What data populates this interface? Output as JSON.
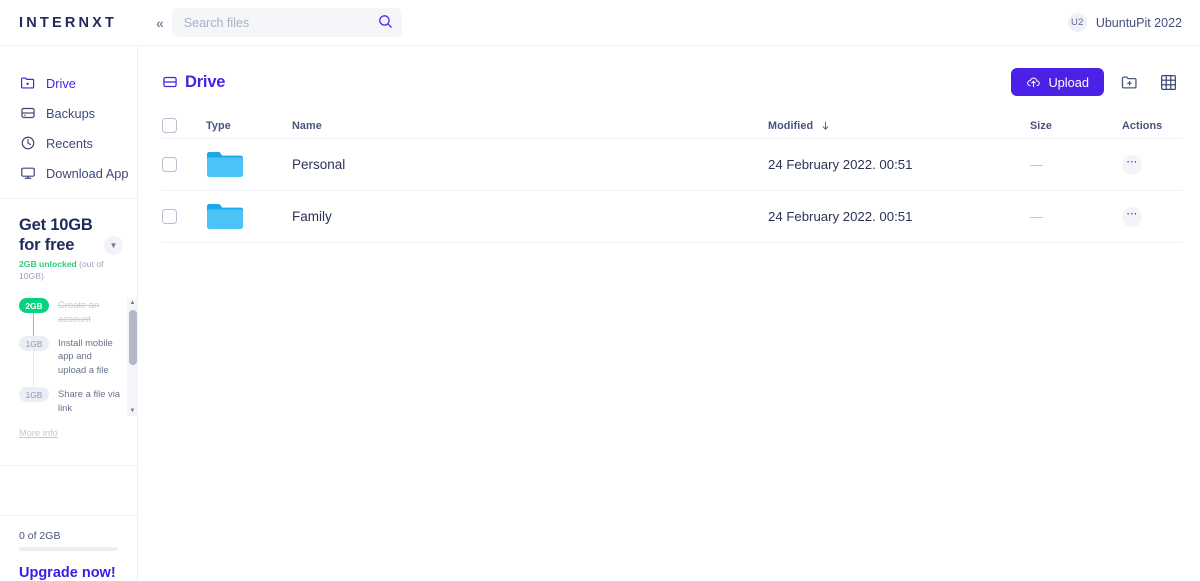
{
  "brand": {
    "name": "INTERNXT",
    "accent": "#4b21e8",
    "green": "#07d37e"
  },
  "topbar": {
    "collapse_icon": "chevron-double-left-icon",
    "search": {
      "placeholder": "Search files",
      "value": ""
    },
    "user": {
      "initials": "U2",
      "name": "UbuntuPit 2022"
    }
  },
  "sidebar": {
    "nav": [
      {
        "label": "Drive",
        "icon": "folder-add-icon",
        "active": true
      },
      {
        "label": "Backups",
        "icon": "hard-drive-icon",
        "active": false
      },
      {
        "label": "Recents",
        "icon": "clock-icon",
        "active": false
      },
      {
        "label": "Download App",
        "icon": "desktop-icon",
        "active": false
      }
    ],
    "referral": {
      "title_line1": "Get 10GB",
      "title_line2": "for free",
      "unlocked": "2GB unlocked",
      "unlocked_rest": " (out of 10GB)",
      "collapse_icon": "chevron-down-icon",
      "steps": [
        {
          "badge": "2GB",
          "text": "Create an account",
          "done": true
        },
        {
          "badge": "1GB",
          "text": "Install mobile app and upload a file",
          "done": false
        },
        {
          "badge": "1GB",
          "text": "Share a file via link",
          "done": false
        }
      ],
      "more_info": "More info"
    },
    "storage": {
      "usage": "0 of 2GB",
      "upgrade": "Upgrade now!",
      "progress_percent": 0
    }
  },
  "main": {
    "title": "Drive",
    "title_icon": "hard-drive-icon",
    "actions": {
      "upload_label": "Upload",
      "upload_icon": "cloud-upload-icon",
      "new_folder_icon": "folder-add-icon",
      "grid_view_icon": "grid-view-icon"
    },
    "table": {
      "columns": [
        "",
        "Type",
        "Name",
        "Modified",
        "Size",
        "Actions"
      ],
      "sort": {
        "column": "Modified",
        "direction": "down-arrow-icon"
      },
      "rows": [
        {
          "type_icon": "folder-icon",
          "name": "Personal",
          "modified": "24 February 2022. 00:51",
          "size": "—",
          "actions_icon": "ellipsis-icon"
        },
        {
          "type_icon": "folder-icon",
          "name": "Family",
          "modified": "24 February 2022. 00:51",
          "size": "—",
          "actions_icon": "ellipsis-icon"
        }
      ]
    }
  }
}
